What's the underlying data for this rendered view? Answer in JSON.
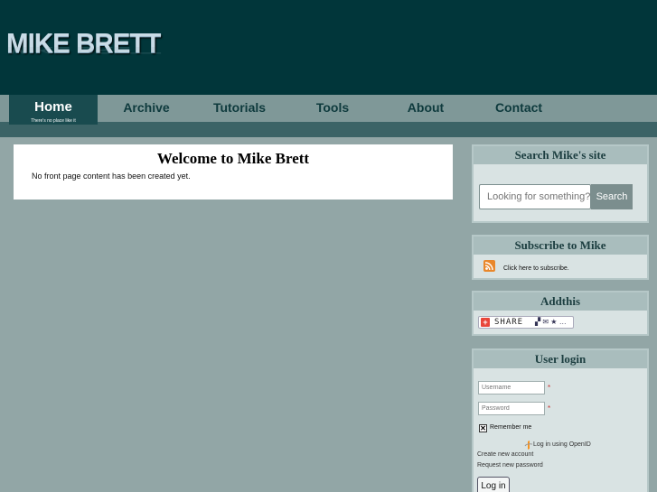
{
  "header": {
    "logo_text": "MIKE BRETT"
  },
  "nav": {
    "items": [
      {
        "label": "Home",
        "active": true
      },
      {
        "label": "Archive"
      },
      {
        "label": "Tutorials"
      },
      {
        "label": "Tools"
      },
      {
        "label": "About"
      },
      {
        "label": "Contact"
      }
    ],
    "tagline": "There's no place like it"
  },
  "main": {
    "title": "Welcome to Mike Brett",
    "body": "No front page content has been created yet."
  },
  "sidebar": {
    "search": {
      "title": "Search Mike's site",
      "placeholder": "Looking for something?",
      "button": "Search"
    },
    "subscribe": {
      "title": "Subscribe to Mike",
      "link": "Click here to subscribe.",
      "icon": "rss-icon"
    },
    "addthis": {
      "title": "Addthis",
      "share_label": "SHARE"
    },
    "login": {
      "title": "User login",
      "username_placeholder": "Username",
      "password_placeholder": "Password",
      "required_mark": "*",
      "remember_label": "Remember me",
      "remember_checked": true,
      "openid_link": "Log in using OpenID",
      "create_link": "Create new account",
      "reset_link": "Request new password",
      "button": "Log in"
    }
  },
  "colors": {
    "header_bg": "#01363a",
    "nav_bg": "#7f9898",
    "nav_active_bg": "#194b4f",
    "page_bg": "#92a6a6",
    "block_title_bg": "#a9bdbd"
  }
}
